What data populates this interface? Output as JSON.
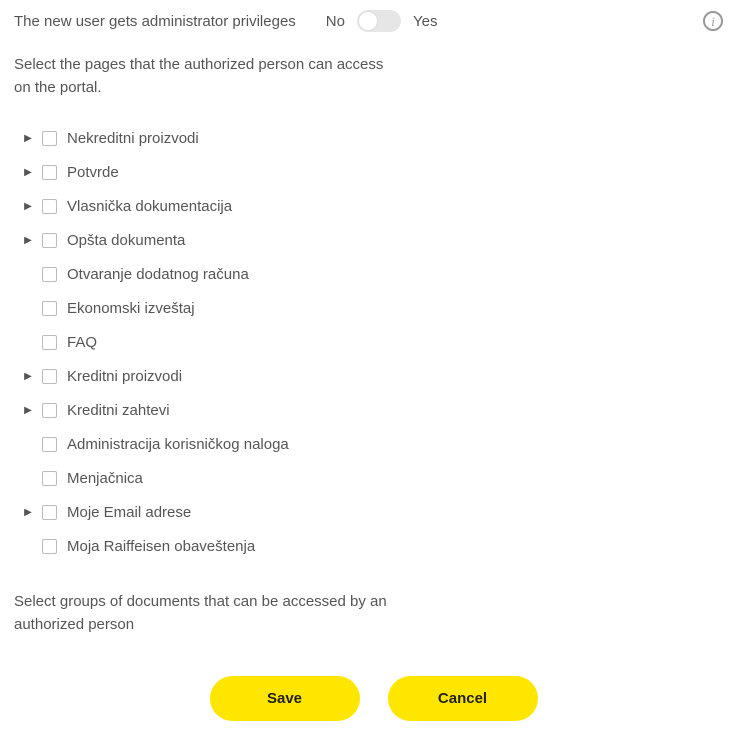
{
  "admin": {
    "label": "The new user gets administrator privileges",
    "no_label": "No",
    "yes_label": "Yes",
    "value": false
  },
  "sections": {
    "pages_label": "Select the pages that the authorized person can access on the portal.",
    "docs_label": "Select groups of documents that can be accessed by an authorized person"
  },
  "tree": [
    {
      "label": "Nekreditni proizvodi",
      "expandable": true
    },
    {
      "label": "Potvrde",
      "expandable": true
    },
    {
      "label": "Vlasnička dokumentacija",
      "expandable": true
    },
    {
      "label": "Opšta dokumenta",
      "expandable": true
    },
    {
      "label": "Otvaranje dodatnog računa",
      "expandable": false
    },
    {
      "label": "Ekonomski izveštaj",
      "expandable": false
    },
    {
      "label": "FAQ",
      "expandable": false
    },
    {
      "label": "Kreditni proizvodi",
      "expandable": true
    },
    {
      "label": "Kreditni zahtevi",
      "expandable": true
    },
    {
      "label": "Administracija korisničkog naloga",
      "expandable": false
    },
    {
      "label": "Menjačnica",
      "expandable": false
    },
    {
      "label": "Moje Email adrese",
      "expandable": true
    },
    {
      "label": "Moja Raiffeisen obaveštenja",
      "expandable": false
    }
  ],
  "buttons": {
    "save": "Save",
    "cancel": "Cancel"
  }
}
